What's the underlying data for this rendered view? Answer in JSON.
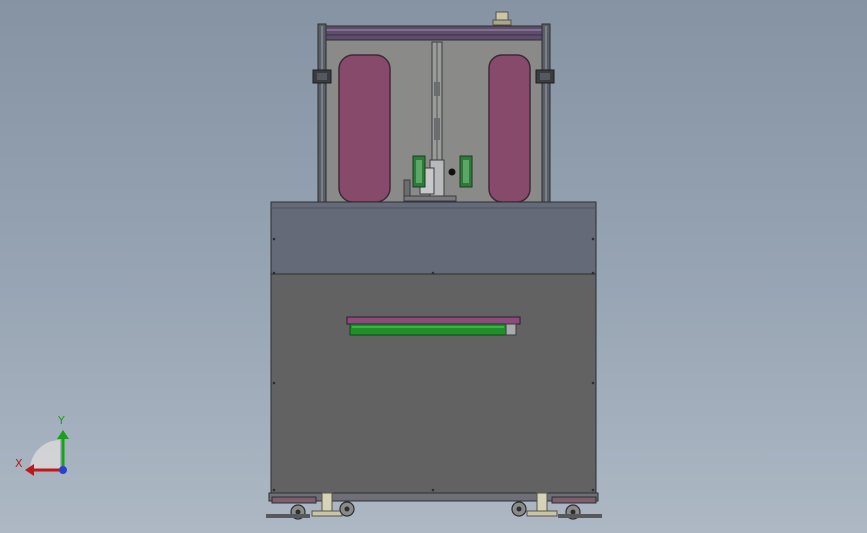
{
  "viewport": {
    "background_top": "#8593a3",
    "background_bottom": "#adb8c4"
  },
  "model": {
    "colors": {
      "frame": "#5a5e66",
      "frame_dark": "#2c2e33",
      "panel": "#626262",
      "panel_top": "#656a78",
      "door_glass": "#8a8b89",
      "window": "#874a6a",
      "rail_purple": "#8b4b7c",
      "rail_green": "#1f8f2b",
      "bracket_green": "#2f7a3a",
      "caster": "#8a8a86",
      "knob": "#c9c5a6"
    }
  },
  "triad": {
    "y_label": "Y",
    "x_label": "X",
    "y_color": "#1aa01a",
    "x_color": "#c01818",
    "z_color": "#2a3fd0"
  }
}
